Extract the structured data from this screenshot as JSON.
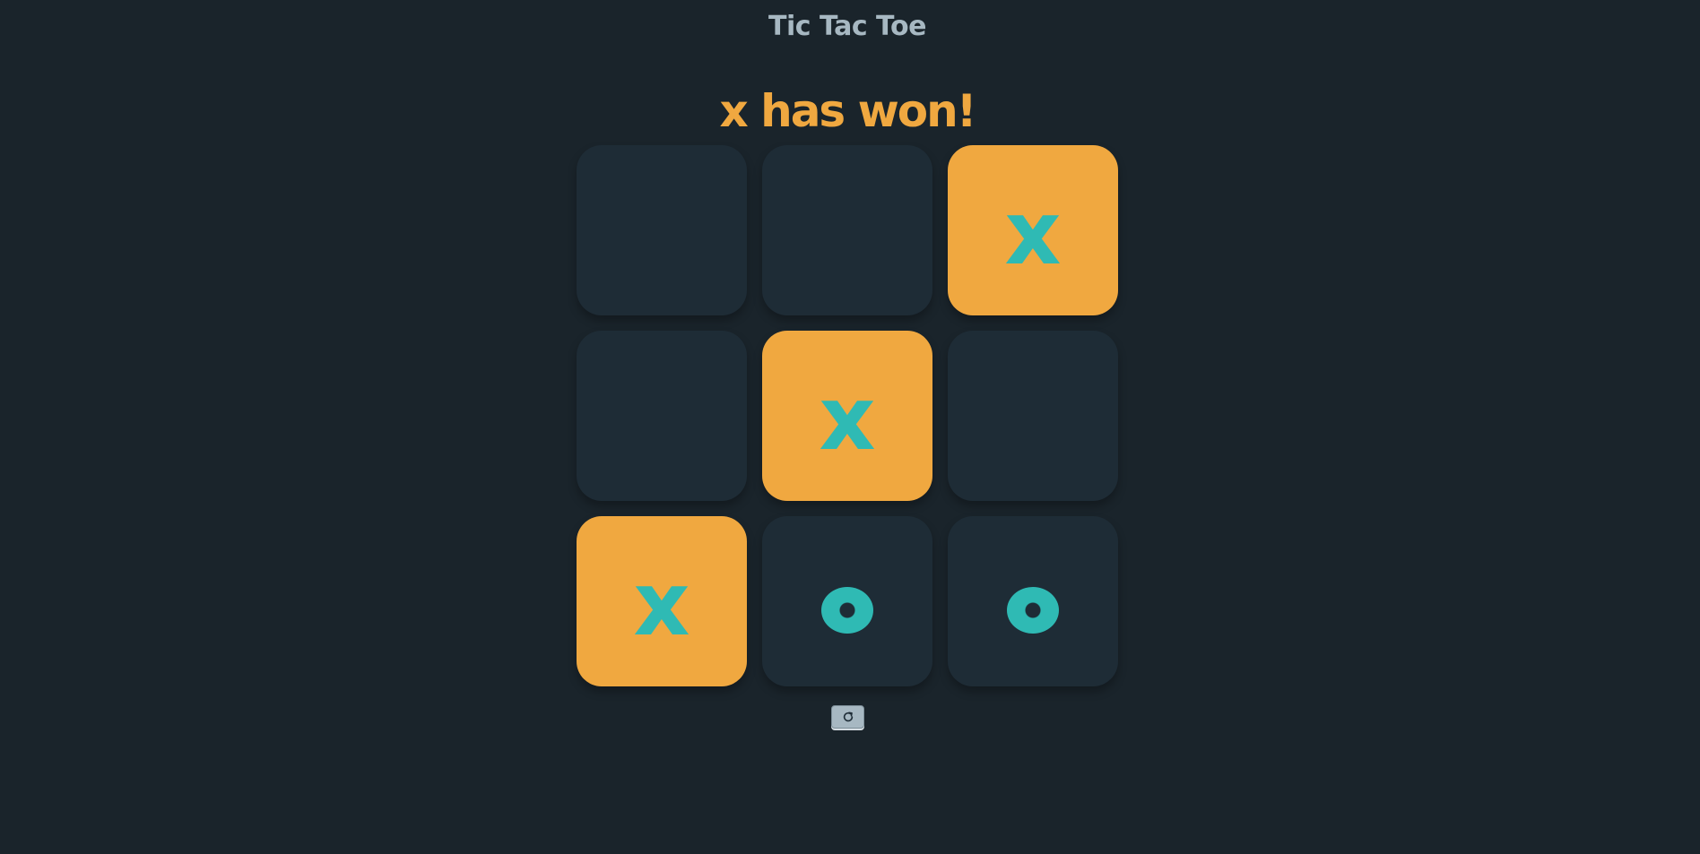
{
  "app": {
    "title": "Tic Tac Toe"
  },
  "game": {
    "status": "x has won!",
    "winner": "x",
    "board": [
      {
        "value": "",
        "winning": false
      },
      {
        "value": "",
        "winning": false
      },
      {
        "value": "x",
        "winning": true
      },
      {
        "value": "",
        "winning": false
      },
      {
        "value": "x",
        "winning": true
      },
      {
        "value": "",
        "winning": false
      },
      {
        "value": "x",
        "winning": true
      },
      {
        "value": "o",
        "winning": false
      },
      {
        "value": "o",
        "winning": false
      }
    ]
  },
  "controls": {
    "restart_icon": "restart-icon"
  },
  "colors": {
    "background": "#1a242b",
    "cell": "#1e2c36",
    "winning_cell": "#f0a840",
    "mark": "#2fbab4",
    "title": "#a7b8c2",
    "status": "#f0a840"
  }
}
